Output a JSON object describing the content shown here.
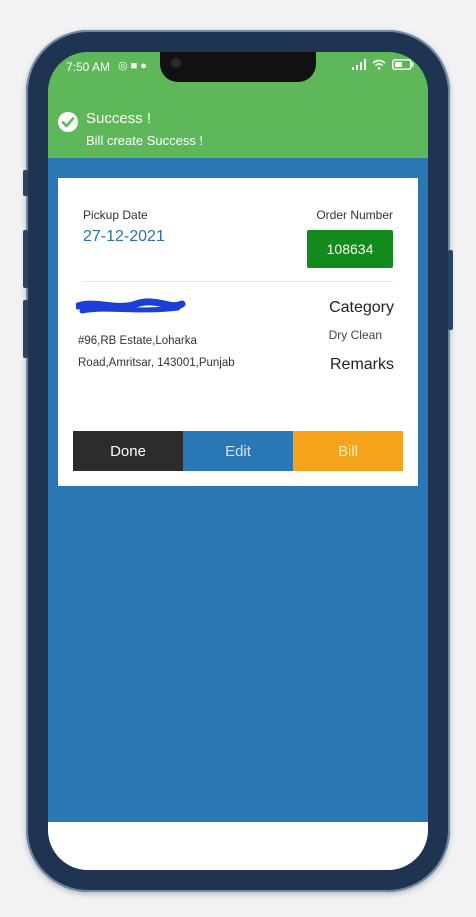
{
  "status_bar": {
    "time": "7:50 AM",
    "left_icons": [
      "notification-icon",
      "video-icon",
      "badge-icon"
    ],
    "right_icons": [
      "signal-icon",
      "wifi-icon",
      "battery-icon"
    ]
  },
  "toast": {
    "title": "Success !",
    "message": "Bill create Success !",
    "color": "#5eb85a"
  },
  "order": {
    "pickup_label": "Pickup Date",
    "pickup_date": "27-12-2021",
    "order_label": "Order Number",
    "order_number": "108634",
    "address": "#96,RB Estate,Loharka Road,Amritsar, 143001,Punjab",
    "category_label": "Category",
    "category_value": "Dry Clean",
    "remarks_label": "Remarks"
  },
  "actions": {
    "done": "Done",
    "edit": "Edit",
    "bill": "Bill"
  },
  "colors": {
    "background": "#2b77b4",
    "order_badge": "#138a1c",
    "done": "#2c2c2c",
    "edit": "#2a77b5",
    "bill": "#f5a31a"
  }
}
